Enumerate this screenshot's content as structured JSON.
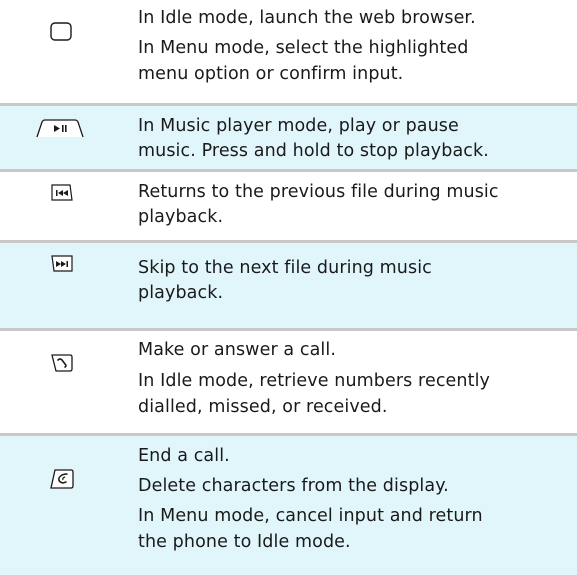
{
  "rows": [
    {
      "icon": "confirm-key-icon",
      "lines": [
        "In Idle mode, launch the web browser.",
        "In Menu mode, select the highlighted",
        "menu option or confirm input."
      ]
    },
    {
      "icon": "play-pause-key-icon",
      "lines": [
        "In Music player mode, play or pause",
        "music. Press and hold to stop playback."
      ]
    },
    {
      "icon": "previous-track-key-icon",
      "lines": [
        "Returns to the previous file during music",
        "playback."
      ]
    },
    {
      "icon": "next-track-key-icon",
      "lines": [
        "Skip to the next file during music",
        "playback."
      ]
    },
    {
      "icon": "dial-key-icon",
      "lines": [
        "Make or answer a call.",
        "In Idle mode, retrieve numbers recently",
        "dialled, missed, or received."
      ]
    },
    {
      "icon": "end-key-icon",
      "lines": [
        "End a call.",
        "Delete characters from the display.",
        "In Menu mode, cancel input and return",
        "the phone to Idle mode."
      ]
    }
  ]
}
